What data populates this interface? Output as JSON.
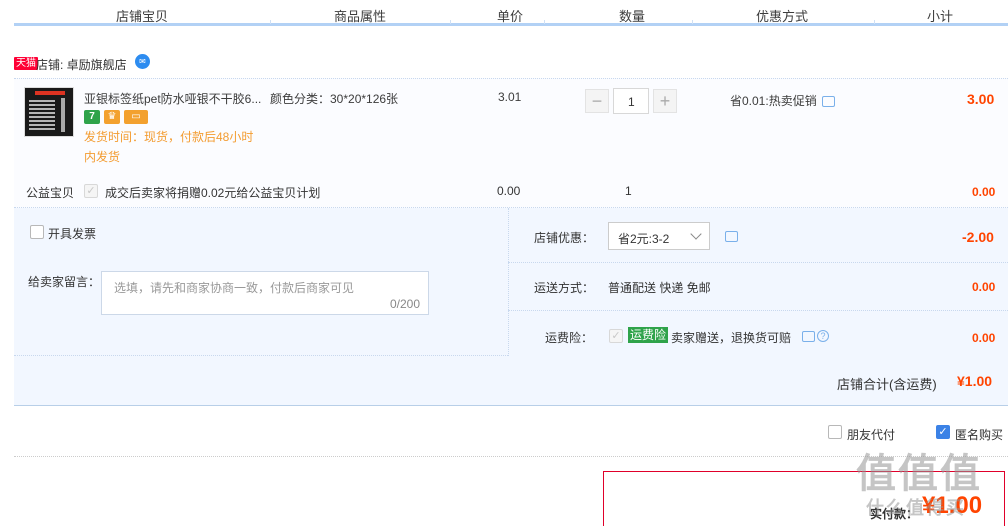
{
  "header": {
    "columns": [
      "店铺宝贝",
      "商品属性",
      "单价",
      "数量",
      "优惠方式",
      "小计"
    ]
  },
  "shop": {
    "badge": "天猫",
    "label": "店铺: 卓励旗舰店"
  },
  "item": {
    "title": "亚银标签纸pet防水哑银不干胶6...",
    "attr": "颜色分类：30*20*126张",
    "price": "3.01",
    "quantity": "1",
    "qty_minus": "−",
    "qty_plus": "+",
    "promo": "省0.01:热卖促销",
    "subtotal": "3.00",
    "ship_time_1": "发货时间：现货，付款后48小时",
    "ship_time_2": "内发货",
    "svc_icons": [
      "seven-day-return-icon",
      "guarantee-icon",
      "card-icon"
    ],
    "svc_seven": "7"
  },
  "charity": {
    "label": "公益宝贝",
    "desc": "成交后卖家将捐赠0.02元给公益宝贝计划",
    "price": "0.00",
    "qty": "1",
    "subtotal": "0.00"
  },
  "invoice": {
    "label": "开具发票"
  },
  "message": {
    "label": "给卖家留言：",
    "placeholder": "选填，请先和商家协商一致，付款后商家可见",
    "count": "0/200"
  },
  "shop_discount": {
    "label": "店铺优惠：",
    "selected": "省2元:3-2",
    "amount": "-2.00"
  },
  "shipping": {
    "label": "运送方式：",
    "value": "普通配送 快递 免邮",
    "amount": "0.00"
  },
  "insurance": {
    "label": "运费险：",
    "badge": "运费险",
    "desc": "卖家赠送，退换货可赔",
    "amount": "0.00"
  },
  "shop_total": {
    "label": "店铺合计(含运费)",
    "value": "¥1.00"
  },
  "options": {
    "friend_pay": "朋友代付",
    "anonymous": "匿名购买"
  },
  "pay": {
    "label": "实付款：",
    "amount": "¥1.00"
  },
  "watermark": {
    "top": "值值值",
    "bottom": "什么值得买"
  },
  "colors": {
    "accent_red": "#ff4400",
    "tmall_red": "#ff0036",
    "header_line": "#b2d1f5",
    "panel_bg": "#f2f7ff"
  }
}
